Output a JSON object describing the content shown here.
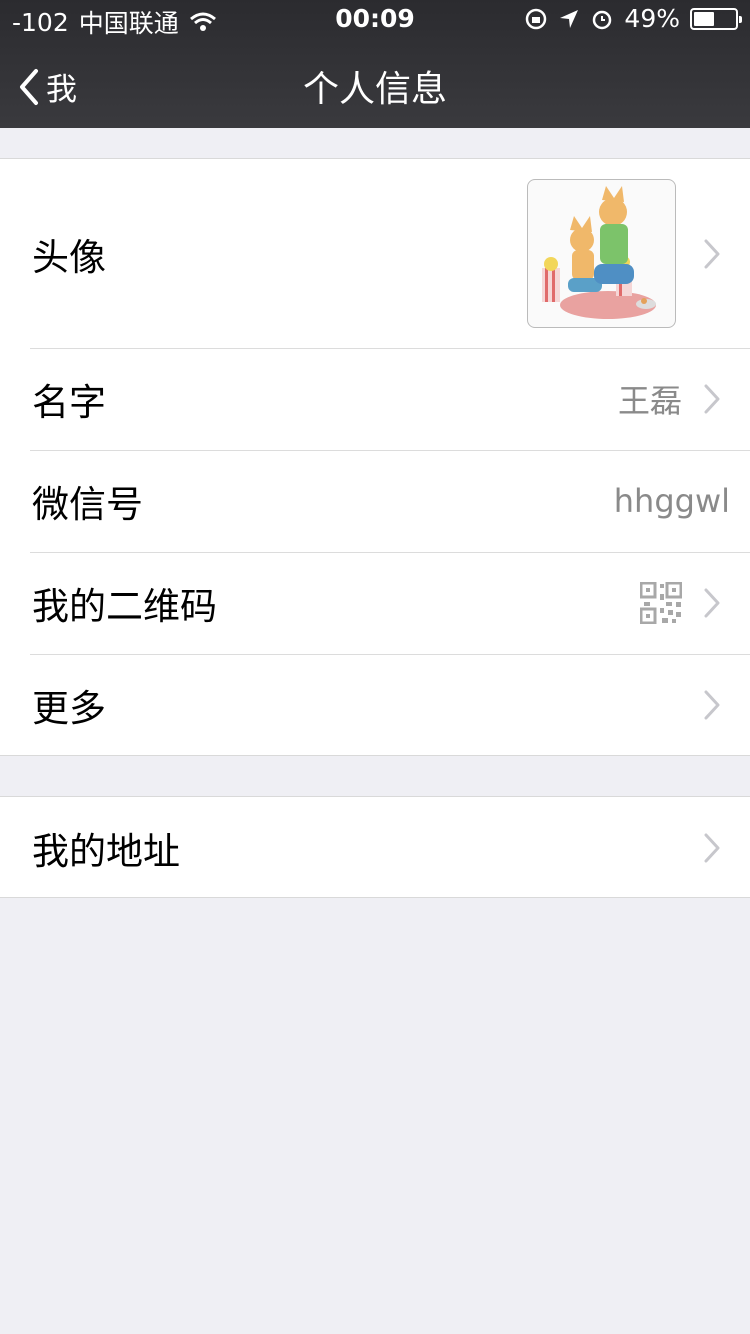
{
  "status_bar": {
    "signal": "-102",
    "carrier": "中国联通",
    "time": "00:09",
    "battery": "49%"
  },
  "nav": {
    "back_label": "我",
    "title": "个人信息"
  },
  "profile": {
    "avatar_label": "头像",
    "name_label": "名字",
    "name_value": "王磊",
    "wechat_id_label": "微信号",
    "wechat_id_value": "hhggwl",
    "qr_label": "我的二维码",
    "more_label": "更多"
  },
  "address": {
    "label": "我的地址"
  }
}
